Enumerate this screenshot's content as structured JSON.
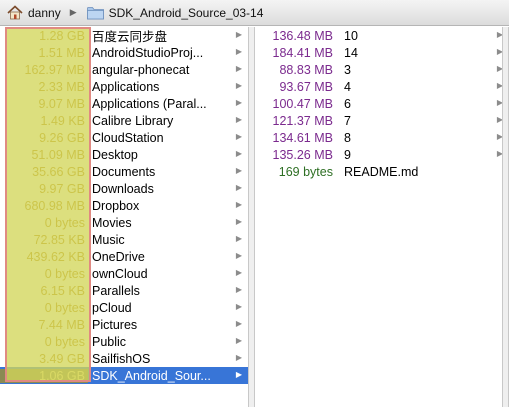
{
  "pathbar": {
    "crumbs": [
      "danny",
      "SDK_Android_Source_03-14"
    ]
  },
  "column1": {
    "rows": [
      {
        "size": "1.28 GB",
        "name": "百度云同步盘"
      },
      {
        "size": "1.51 MB",
        "name": "AndroidStudioProj..."
      },
      {
        "size": "162.97 MB",
        "name": "angular-phonecat"
      },
      {
        "size": "2.33 MB",
        "name": "Applications"
      },
      {
        "size": "9.07 MB",
        "name": "Applications (Paral..."
      },
      {
        "size": "1.49 KB",
        "name": "Calibre Library"
      },
      {
        "size": "9.26 GB",
        "name": "CloudStation"
      },
      {
        "size": "51.09 MB",
        "name": "Desktop"
      },
      {
        "size": "35.66 GB",
        "name": "Documents"
      },
      {
        "size": "9.97 GB",
        "name": "Downloads"
      },
      {
        "size": "680.98 MB",
        "name": "Dropbox"
      },
      {
        "size": "0 bytes",
        "name": "Movies"
      },
      {
        "size": "72.85 KB",
        "name": "Music"
      },
      {
        "size": "439.62 KB",
        "name": "OneDrive"
      },
      {
        "size": "0 bytes",
        "name": "ownCloud"
      },
      {
        "size": "6.15 KB",
        "name": "Parallels"
      },
      {
        "size": "0 bytes",
        "name": "pCloud"
      },
      {
        "size": "7.44 MB",
        "name": "Pictures"
      },
      {
        "size": "0 bytes",
        "name": "Public"
      },
      {
        "size": "3.49 GB",
        "name": "SailfishOS"
      },
      {
        "size": "1.06 GB",
        "name": "SDK_Android_Sour..."
      }
    ],
    "selected_index": 20
  },
  "column2": {
    "rows": [
      {
        "size": "136.48 MB",
        "name": "10",
        "kind": "folder"
      },
      {
        "size": "184.41 MB",
        "name": "14",
        "kind": "folder"
      },
      {
        "size": "88.83 MB",
        "name": "3",
        "kind": "folder"
      },
      {
        "size": "93.67 MB",
        "name": "4",
        "kind": "folder"
      },
      {
        "size": "100.47 MB",
        "name": "6",
        "kind": "folder"
      },
      {
        "size": "121.37 MB",
        "name": "7",
        "kind": "folder"
      },
      {
        "size": "134.61 MB",
        "name": "8",
        "kind": "folder"
      },
      {
        "size": "135.26 MB",
        "name": "9",
        "kind": "folder"
      },
      {
        "size": "169 bytes",
        "name": "README.md",
        "kind": "file"
      }
    ]
  },
  "icons": {
    "path_home": "home-icon",
    "path_folder": "folder-icon",
    "separator": "chevron-right-icon",
    "disclosure": "disclosure-triangle-icon"
  },
  "colors": {
    "selection": "#3875d7",
    "size_highlight": "#d2d65a",
    "size_highlight_border": "#e08a82",
    "folder_size_text": "#7b2a8e",
    "file_size_text": "#2e6f24"
  }
}
